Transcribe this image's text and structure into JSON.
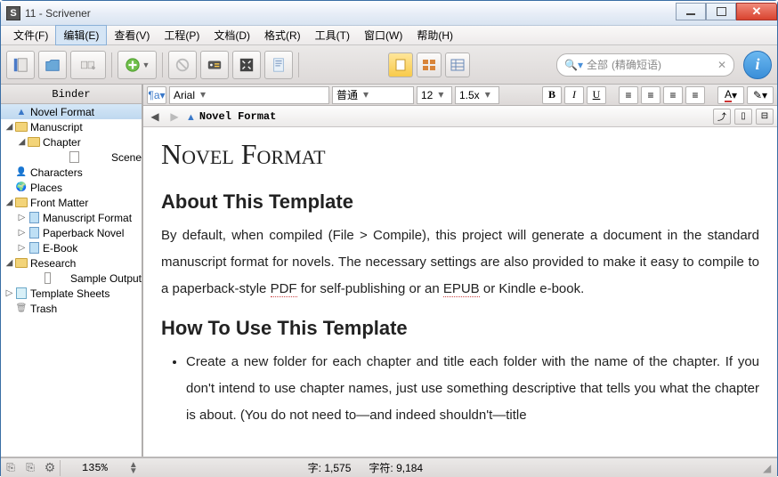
{
  "window": {
    "title": "11 - Scrivener"
  },
  "menu": {
    "items": [
      "文件(F)",
      "编辑(E)",
      "查看(V)",
      "工程(P)",
      "文档(D)",
      "格式(R)",
      "工具(T)",
      "窗口(W)",
      "帮助(H)"
    ],
    "selected_index": 1
  },
  "search": {
    "mag": "🔍",
    "scope": "全部",
    "placeholder": "(精确短语)"
  },
  "binder": {
    "title": "Binder",
    "items": [
      {
        "indent": 0,
        "tw": "",
        "icon": "warn",
        "label": "Novel Format",
        "sel": true
      },
      {
        "indent": 0,
        "tw": "◢",
        "icon": "folder",
        "label": "Manuscript"
      },
      {
        "indent": 1,
        "tw": "◢",
        "icon": "folder",
        "label": "Chapter"
      },
      {
        "indent": 2,
        "tw": "",
        "icon": "doc",
        "label": "Scene"
      },
      {
        "indent": 0,
        "tw": "",
        "icon": "people",
        "label": "Characters"
      },
      {
        "indent": 0,
        "tw": "",
        "icon": "globe",
        "label": "Places"
      },
      {
        "indent": 0,
        "tw": "◢",
        "icon": "folder",
        "label": "Front Matter"
      },
      {
        "indent": 1,
        "tw": "▷",
        "icon": "bluedoc",
        "label": "Manuscript Format"
      },
      {
        "indent": 1,
        "tw": "▷",
        "icon": "bluedoc",
        "label": "Paperback Novel"
      },
      {
        "indent": 1,
        "tw": "▷",
        "icon": "bluedoc",
        "label": "E-Book"
      },
      {
        "indent": 0,
        "tw": "◢",
        "icon": "folder",
        "label": "Research"
      },
      {
        "indent": 1,
        "tw": "",
        "icon": "doc",
        "label": "Sample Output"
      },
      {
        "indent": 0,
        "tw": "▷",
        "icon": "tpl",
        "label": "Template Sheets"
      },
      {
        "indent": 0,
        "tw": "",
        "icon": "trash",
        "label": "Trash"
      }
    ]
  },
  "format": {
    "font": "Arial",
    "style": "普通",
    "size": "12",
    "spacing": "1.5x"
  },
  "header": {
    "doc_title": "Novel Format"
  },
  "content": {
    "title": "Novel Format",
    "h2a": "About This Template",
    "p1_a": "By default, when compiled (File > Compile), this project will generate a document in the standard manuscript format for novels. The necessary settings are also provided to make it easy to compile to a paperback-style ",
    "pdf": "PDF",
    "p1_b": " for self-publishing or an ",
    "epub": "EPUB",
    "p1_c": " or Kindle e-book.",
    "h2b": "How To Use This Template",
    "li1": "Create a new folder for each chapter and title each folder with the name of the chapter. If you don't intend to use chapter names, just use something descriptive that tells you what the chapter is about. (You do not need to—and indeed shouldn't—title"
  },
  "status": {
    "zoom": "135%",
    "words_label": "字:",
    "words": "1,575",
    "chars_label": "字符:",
    "chars": "9,184"
  }
}
